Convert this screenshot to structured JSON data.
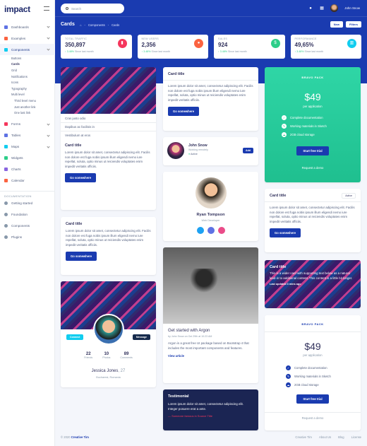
{
  "brand": "impact",
  "sidebar": {
    "nav": [
      {
        "label": "Dashboards",
        "color": "#5e72e4"
      },
      {
        "label": "Examples",
        "color": "#fb6340"
      },
      {
        "label": "Components",
        "color": "#11cdef",
        "active": true
      }
    ],
    "subs": [
      "Buttons",
      "Cards",
      "Grid",
      "Notifications",
      "Icons",
      "Typography",
      "Multi level"
    ],
    "deep": [
      "Third level menu",
      "Just another link",
      "One last link"
    ],
    "nav2": [
      {
        "label": "Forms",
        "color": "#f5365c"
      },
      {
        "label": "Tables",
        "color": "#5e72e4"
      },
      {
        "label": "Maps",
        "color": "#11cdef"
      },
      {
        "label": "Widgets",
        "color": "#2dce89"
      },
      {
        "label": "Charts",
        "color": "#8965e0"
      },
      {
        "label": "Calendar",
        "color": "#fb6340"
      }
    ],
    "doc_heading": "DOCUMENTATION",
    "docs": [
      "Getting started",
      "Foundation",
      "Components",
      "Plugins"
    ]
  },
  "topbar": {
    "search_placeholder": "Search",
    "user": "John Snow"
  },
  "page": {
    "title": "Cards",
    "crumb": "Components",
    "current": "Cards",
    "btn_new": "New",
    "btn_filters": "Filters"
  },
  "stats": [
    {
      "label": "TOTAL TRAFFIC",
      "value": "350,897",
      "change": "↑ 3.48%",
      "since": "Since last month",
      "color": "#f5365c",
      "icon": "▮"
    },
    {
      "label": "NEW USERS",
      "value": "2,356",
      "change": "↑ 3.48%",
      "since": "Since last month",
      "color": "#fb6340",
      "icon": "●"
    },
    {
      "label": "SALES",
      "value": "924",
      "change": "↑ 3.48%",
      "since": "Since last month",
      "color": "#2dce89",
      "icon": "$"
    },
    {
      "label": "PERFORMANCE",
      "value": "49,65%",
      "change": "↑ 3.48%",
      "since": "Since last month",
      "color": "#11cdef",
      "icon": "▥"
    }
  ],
  "list": [
    "Cras justo odio",
    "Dapibus ac facilisis in",
    "Vestibulum at eros"
  ],
  "card_title": "Card title",
  "card_text": "Lorem ipsum dolor sit amet, consectetur adipiscing elit. Facilis non dolore est fuga nobis ipsum illum eligendi nemo iure repellat, soluta, optio minus ut reiciendis voluptates enim impedit veritatis officiis.",
  "go": "Go somewhere",
  "profile_small": {
    "name": "John Snow",
    "role": "Working remotely",
    "status": "Active",
    "add": "Add"
  },
  "profile_center": {
    "name": "Ryan Tompson",
    "role": "Web Developer"
  },
  "profile": {
    "connect": "Connect",
    "message": "Message",
    "friends": "22",
    "friends_l": "Friends",
    "photos": "10",
    "photos_l": "Photos",
    "comments": "89",
    "comments_l": "Comments",
    "name": "Jessica Jones",
    "age": ", 27",
    "location": "Bucharest, Romania"
  },
  "argon": {
    "title": "Get started with Argon",
    "meta": "by John Snow on Oct 29th at 10:23 AM",
    "text": "Argon is a great free UI package based on Bootstrap 4 that includes the most important components and features.",
    "link": "View article"
  },
  "testimonial": {
    "title": "Testimonial",
    "text": "Lorem ipsum dolor sit amet, consectetur adipiscing elit. Integer posuere erat a ante.",
    "author": "— Someone famous in Source Title"
  },
  "pricing1": {
    "tag": "BRAVO PACK",
    "price": "$49",
    "per": "per application",
    "features": [
      "Complete documentation",
      "Working materials in Sketch",
      "2GB cloud storage"
    ],
    "btn": "Start free trial",
    "demo": "Request a demo"
  },
  "card_active": "Active",
  "overlay": {
    "title": "Card title",
    "text": "This is a wider card with supporting text below as a natural lead-in to additional content. This content is a little bit longer.",
    "updated": "Last updated 3 mins ago"
  },
  "pricing2": {
    "tag": "BRAVO PACK",
    "price": "$49",
    "per": "per application",
    "features": [
      "Complete documentation",
      "Working materials in Sketch",
      "2GB cloud storage"
    ],
    "btn": "Start free trial",
    "demo": "Request a demo"
  },
  "footer": {
    "copy": "© 2020",
    "brand": "Creative Tim",
    "links": [
      "Creative Tim",
      "About Us",
      "Blog",
      "License"
    ]
  }
}
